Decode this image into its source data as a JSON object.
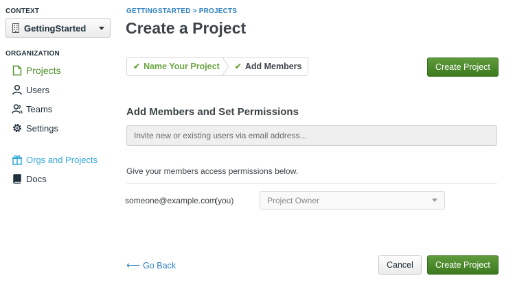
{
  "sidebar": {
    "context_label": "CONTEXT",
    "context_value": "GettingStarted",
    "organization_label": "ORGANIZATION",
    "items": [
      {
        "label": "Projects",
        "icon": "file-icon"
      },
      {
        "label": "Users",
        "icon": "user-icon"
      },
      {
        "label": "Teams",
        "icon": "team-icon"
      },
      {
        "label": "Settings",
        "icon": "gear-icon"
      }
    ],
    "links": [
      {
        "label": "Orgs and Projects",
        "icon": "gift-icon"
      },
      {
        "label": "Docs",
        "icon": "book-icon"
      }
    ]
  },
  "header": {
    "breadcrumb": "GETTINGSTARTED > PROJECTS",
    "title": "Create a Project"
  },
  "wizard": {
    "steps": [
      {
        "label": "Name Your Project",
        "state": "done"
      },
      {
        "label": "Add Members",
        "state": "current"
      }
    ]
  },
  "buttons": {
    "create_project_top": "Create Project",
    "cancel": "Cancel",
    "create_project_bottom": "Create Project",
    "go_back": "Go Back"
  },
  "members": {
    "section_title": "Add Members and Set Permissions",
    "invite_placeholder": "Invite new or existing users via email address...",
    "help_text": "Give your members access permissions below.",
    "rows": [
      {
        "email": "someone@example.com",
        "suffix": "(you)",
        "role": "Project Owner"
      }
    ]
  },
  "colors": {
    "accent_green": "#4a8d27",
    "link_blue": "#2d7fc0",
    "link_cyan": "#36a8da",
    "button_green": "#3c7a1f"
  }
}
